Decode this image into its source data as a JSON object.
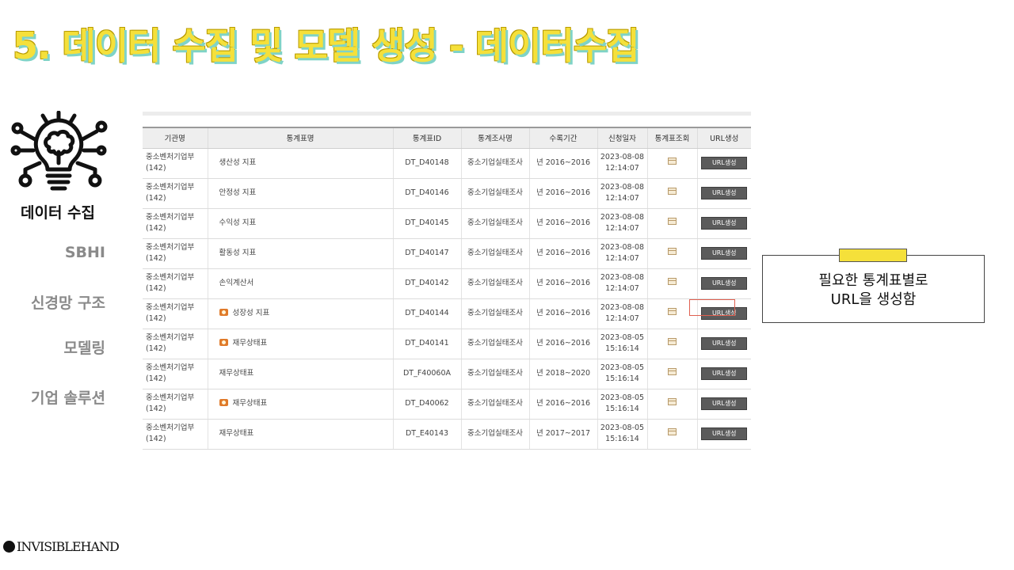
{
  "slide": {
    "title": "5. 데이터 수집 및 모델 생성 - 데이터수집",
    "section_title": "데이터 수집",
    "nav": [
      "SBHI",
      "신경망 구조",
      "모델링",
      "기업 솔루션"
    ],
    "callout": {
      "line1": "필요한 통계표별로",
      "line2": "URL을 생성함"
    },
    "brand": "INVISIBLEHAND",
    "icon": "lightbulb-brain-network-icon",
    "colors": {
      "title_yellow": "#f5e03a",
      "title_shadow": "#7fd3c7",
      "button_gray": "#5b5b5b",
      "highlight_red": "#e06050"
    }
  },
  "table": {
    "headers": [
      "기관명",
      "통계표명",
      "통계표ID",
      "통계조사명",
      "수록기간",
      "신청일자",
      "통계표조회",
      "URL생성"
    ],
    "button_label": "URL생성",
    "rows": [
      {
        "org": "중소벤처기업부",
        "org_code": "(142)",
        "name": "생산성 지표",
        "icon": false,
        "id": "DT_D40148",
        "survey": "중소기업실태조사",
        "period": "년 2016~2016",
        "date": "2023-08-08",
        "time": "12:14:07"
      },
      {
        "org": "중소벤처기업부",
        "org_code": "(142)",
        "name": "안정성 지표",
        "icon": false,
        "id": "DT_D40146",
        "survey": "중소기업실태조사",
        "period": "년 2016~2016",
        "date": "2023-08-08",
        "time": "12:14:07"
      },
      {
        "org": "중소벤처기업부",
        "org_code": "(142)",
        "name": "수익성 지표",
        "icon": false,
        "id": "DT_D40145",
        "survey": "중소기업실태조사",
        "period": "년 2016~2016",
        "date": "2023-08-08",
        "time": "12:14:07"
      },
      {
        "org": "중소벤처기업부",
        "org_code": "(142)",
        "name": "활동성 지표",
        "icon": false,
        "id": "DT_D40147",
        "survey": "중소기업실태조사",
        "period": "년 2016~2016",
        "date": "2023-08-08",
        "time": "12:14:07"
      },
      {
        "org": "중소벤처기업부",
        "org_code": "(142)",
        "name": "손익계산서",
        "icon": false,
        "id": "DT_D40142",
        "survey": "중소기업실태조사",
        "period": "년 2016~2016",
        "date": "2023-08-08",
        "time": "12:14:07"
      },
      {
        "org": "중소벤처기업부",
        "org_code": "(142)",
        "name": "성장성 지표",
        "icon": true,
        "id": "DT_D40144",
        "survey": "중소기업실태조사",
        "period": "년 2016~2016",
        "date": "2023-08-08",
        "time": "12:14:07"
      },
      {
        "org": "중소벤처기업부",
        "org_code": "(142)",
        "name": "재무상태표",
        "icon": true,
        "id": "DT_D40141",
        "survey": "중소기업실태조사",
        "period": "년 2016~2016",
        "date": "2023-08-05",
        "time": "15:16:14"
      },
      {
        "org": "중소벤처기업부",
        "org_code": "(142)",
        "name": "재무상태표",
        "icon": false,
        "id": "DT_F40060A",
        "survey": "중소기업실태조사",
        "period": "년 2018~2020",
        "date": "2023-08-05",
        "time": "15:16:14"
      },
      {
        "org": "중소벤처기업부",
        "org_code": "(142)",
        "name": "재무상태표",
        "icon": true,
        "id": "DT_D40062",
        "survey": "중소기업실태조사",
        "period": "년 2016~2016",
        "date": "2023-08-05",
        "time": "15:16:14"
      },
      {
        "org": "중소벤처기업부",
        "org_code": "(142)",
        "name": "재무상태표",
        "icon": false,
        "id": "DT_E40143",
        "survey": "중소기업실태조사",
        "period": "년 2017~2017",
        "date": "2023-08-05",
        "time": "15:16:14"
      }
    ]
  }
}
